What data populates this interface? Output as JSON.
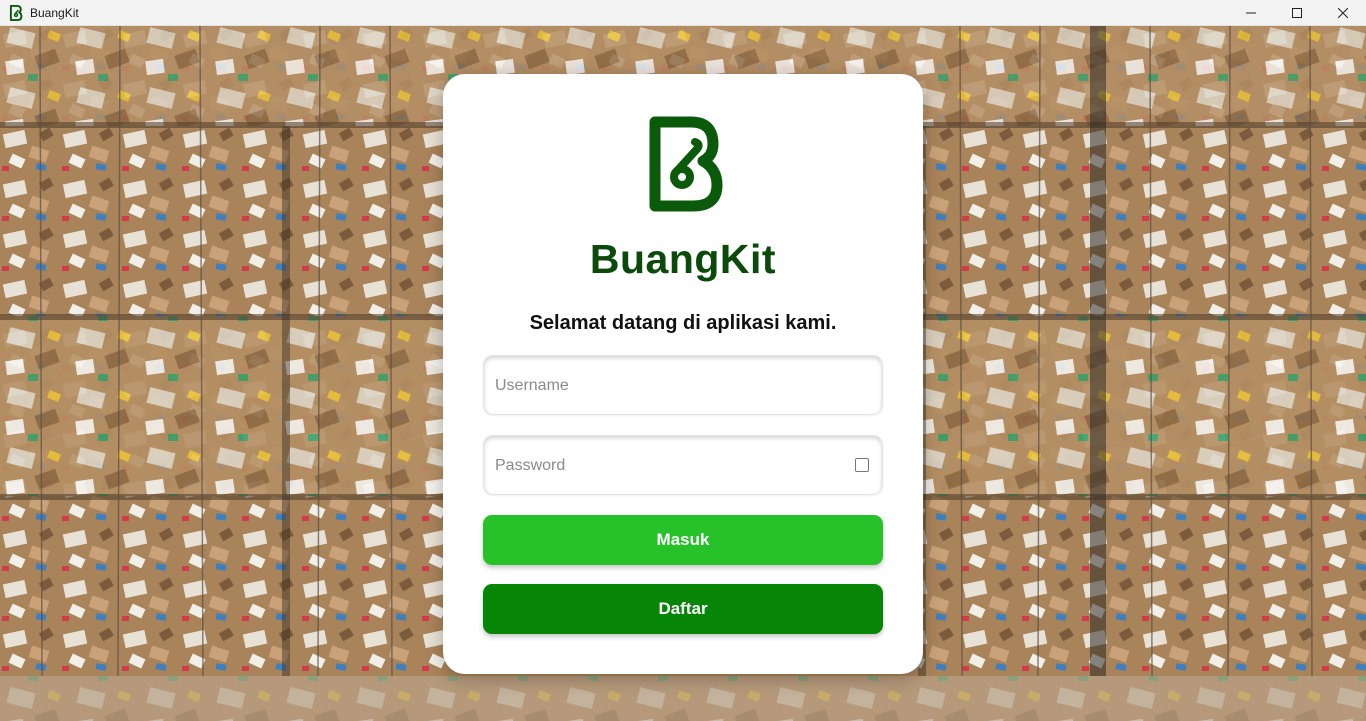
{
  "window": {
    "title": "BuangKit",
    "icon": "buangkit-logo-icon",
    "controls": [
      "minimize-icon",
      "maximize-icon",
      "close-icon"
    ]
  },
  "login": {
    "brand": "BuangKit",
    "welcome": "Selamat datang di aplikasi kami.",
    "username_placeholder": "Username",
    "username_value": "",
    "password_placeholder": "Password",
    "password_value": "",
    "show_password_checked": false,
    "login_label": "Masuk",
    "register_label": "Daftar"
  },
  "colors": {
    "brand_dark_green": "#0b4a0b",
    "button_masuk": "#27c22a",
    "button_daftar": "#078507",
    "card_background": "#ffffff"
  },
  "background": {
    "icon": "recycled-cardboard-bales-photo"
  }
}
